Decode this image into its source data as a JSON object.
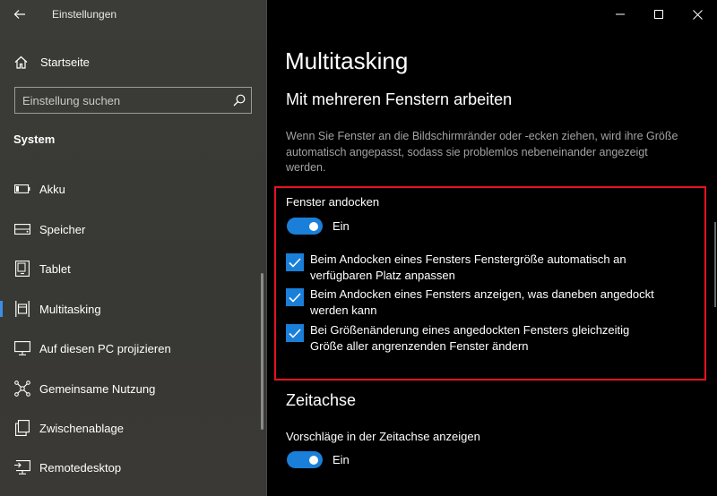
{
  "window": {
    "app_title": "Einstellungen"
  },
  "sidebar": {
    "home_label": "Startseite",
    "search_placeholder": "Einstellung suchen",
    "section_label": "System",
    "items": [
      {
        "label": "Akku",
        "icon": "battery-icon"
      },
      {
        "label": "Speicher",
        "icon": "storage-icon"
      },
      {
        "label": "Tablet",
        "icon": "tablet-icon"
      },
      {
        "label": "Multitasking",
        "icon": "multitasking-icon",
        "active": true
      },
      {
        "label": "Auf diesen PC projizieren",
        "icon": "project-icon"
      },
      {
        "label": "Gemeinsame Nutzung",
        "icon": "share-icon"
      },
      {
        "label": "Zwischenablage",
        "icon": "clipboard-icon"
      },
      {
        "label": "Remotedesktop",
        "icon": "remote-desktop-icon"
      }
    ]
  },
  "main": {
    "title": "Multitasking",
    "snap": {
      "heading": "Mit mehreren Fenstern arbeiten",
      "description": "Wenn Sie Fenster an die Bildschirmränder oder -ecken ziehen, wird ihre Größe automatisch angepasst, sodass sie problemlos nebeneinander angezeigt werden.",
      "toggle_label": "Fenster andocken",
      "toggle_state": "Ein",
      "checkboxes": [
        {
          "label": "Beim Andocken eines Fensters Fenstergröße automatisch an verfügbaren Platz anpassen",
          "checked": true
        },
        {
          "label": "Beim Andocken eines Fensters anzeigen, was daneben angedockt werden kann",
          "checked": true
        },
        {
          "label": "Bei Größenänderung eines angedockten Fensters gleichzeitig Größe aller angrenzenden Fenster ändern",
          "checked": true
        }
      ]
    },
    "timeline": {
      "heading": "Zeitachse",
      "toggle_label": "Vorschläge in der Zeitachse anzeigen",
      "toggle_state": "Ein"
    }
  },
  "colors": {
    "accent": "#1a7fd8",
    "highlight_box": "#e81123",
    "sidebar_bg": "#3a3936",
    "main_bg": "#000000"
  }
}
